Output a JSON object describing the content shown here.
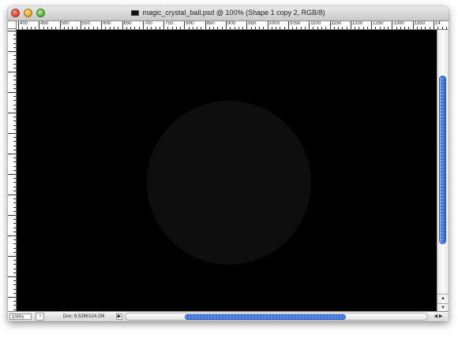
{
  "window": {
    "title": "magic_crystal_ball.psd @ 100% (Shape 1 copy 2, RGB/8)"
  },
  "ruler": {
    "h_labels": [
      "400",
      "450",
      "500",
      "550",
      "600",
      "650",
      "700",
      "750",
      "800",
      "850",
      "900",
      "950",
      "1000",
      "1050",
      "1100",
      "1150",
      "1200",
      "1250",
      "1300",
      "1350",
      "14"
    ]
  },
  "status": {
    "zoom": "100%",
    "doc_info": "Doc: 6.52M/124.2M",
    "menu_arrow": "▶"
  },
  "colors": {
    "canvas": "#000000",
    "sphere": "#0e0e0e",
    "scroll_thumb": "#3d74d6"
  }
}
